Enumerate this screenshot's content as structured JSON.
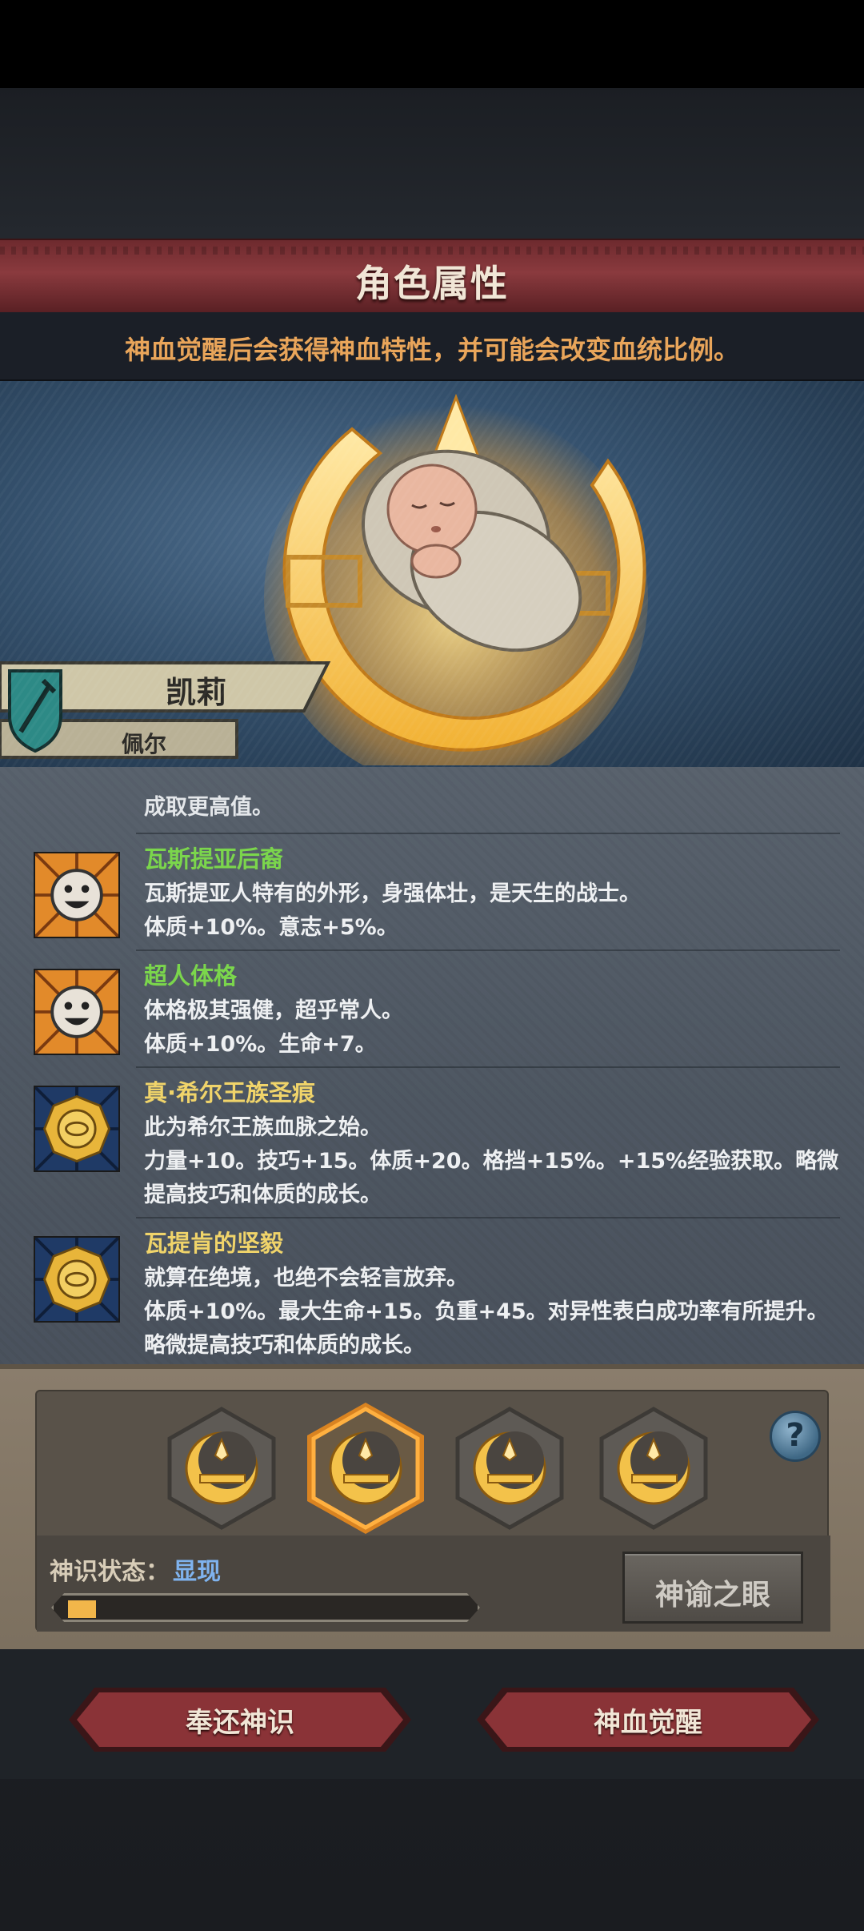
{
  "header": {
    "title": "角色属性",
    "subtitle": "神血觉醒后会获得神血特性，并可能会改变血统比例。"
  },
  "character": {
    "name": "凯莉",
    "lineage": "佩尔"
  },
  "traits_partial_line": "成取更高值。",
  "traits": [
    {
      "name": "瓦斯提亚后裔",
      "name_color": "#7bd64c",
      "icon": "smiley-face-icon",
      "lines": [
        "瓦斯提亚人特有的外形，身强体壮，是天生的战士。",
        "体质+10%。意志+5%。"
      ]
    },
    {
      "name": "超人体格",
      "name_color": "#7bd64c",
      "icon": "smiley-face-icon",
      "lines": [
        "体格极其强健，超乎常人。",
        "体质+10%。生命+7。"
      ]
    },
    {
      "name": "真·希尔王族圣痕",
      "name_color": "#f0d46a",
      "icon": "golden-seal-icon",
      "lines": [
        "此为希尔王族血脉之始。",
        "力量+10。技巧+15。体质+20。格挡+15%。+15%经验获取。略微",
        "提高技巧和体质的成长。"
      ]
    },
    {
      "name": "瓦提肯的坚毅",
      "name_color": "#f0d46a",
      "icon": "golden-seal-icon",
      "lines": [
        "就算在绝境，也绝不会轻言放弃。",
        "体质+10%。最大生命+15。负重+45。对异性表白成功率有所提升。",
        "略微提高技巧和体质的成长。"
      ]
    }
  ],
  "divine_slots": {
    "icon": "divine-crescent-icon",
    "count": 4,
    "selected_index": 1
  },
  "status": {
    "label": "神识状态：",
    "value": "显现",
    "progress": 0.07
  },
  "buttons": {
    "help": "?",
    "oracle_eye": "神谕之眼",
    "return": "奉还神识",
    "awaken": "神血觉醒"
  },
  "colors": {
    "title_bar": "#8a3a3e",
    "subtitle_text": "#e9a55a",
    "gold": "#f2b64a",
    "status_value": "#7fb3ee"
  }
}
